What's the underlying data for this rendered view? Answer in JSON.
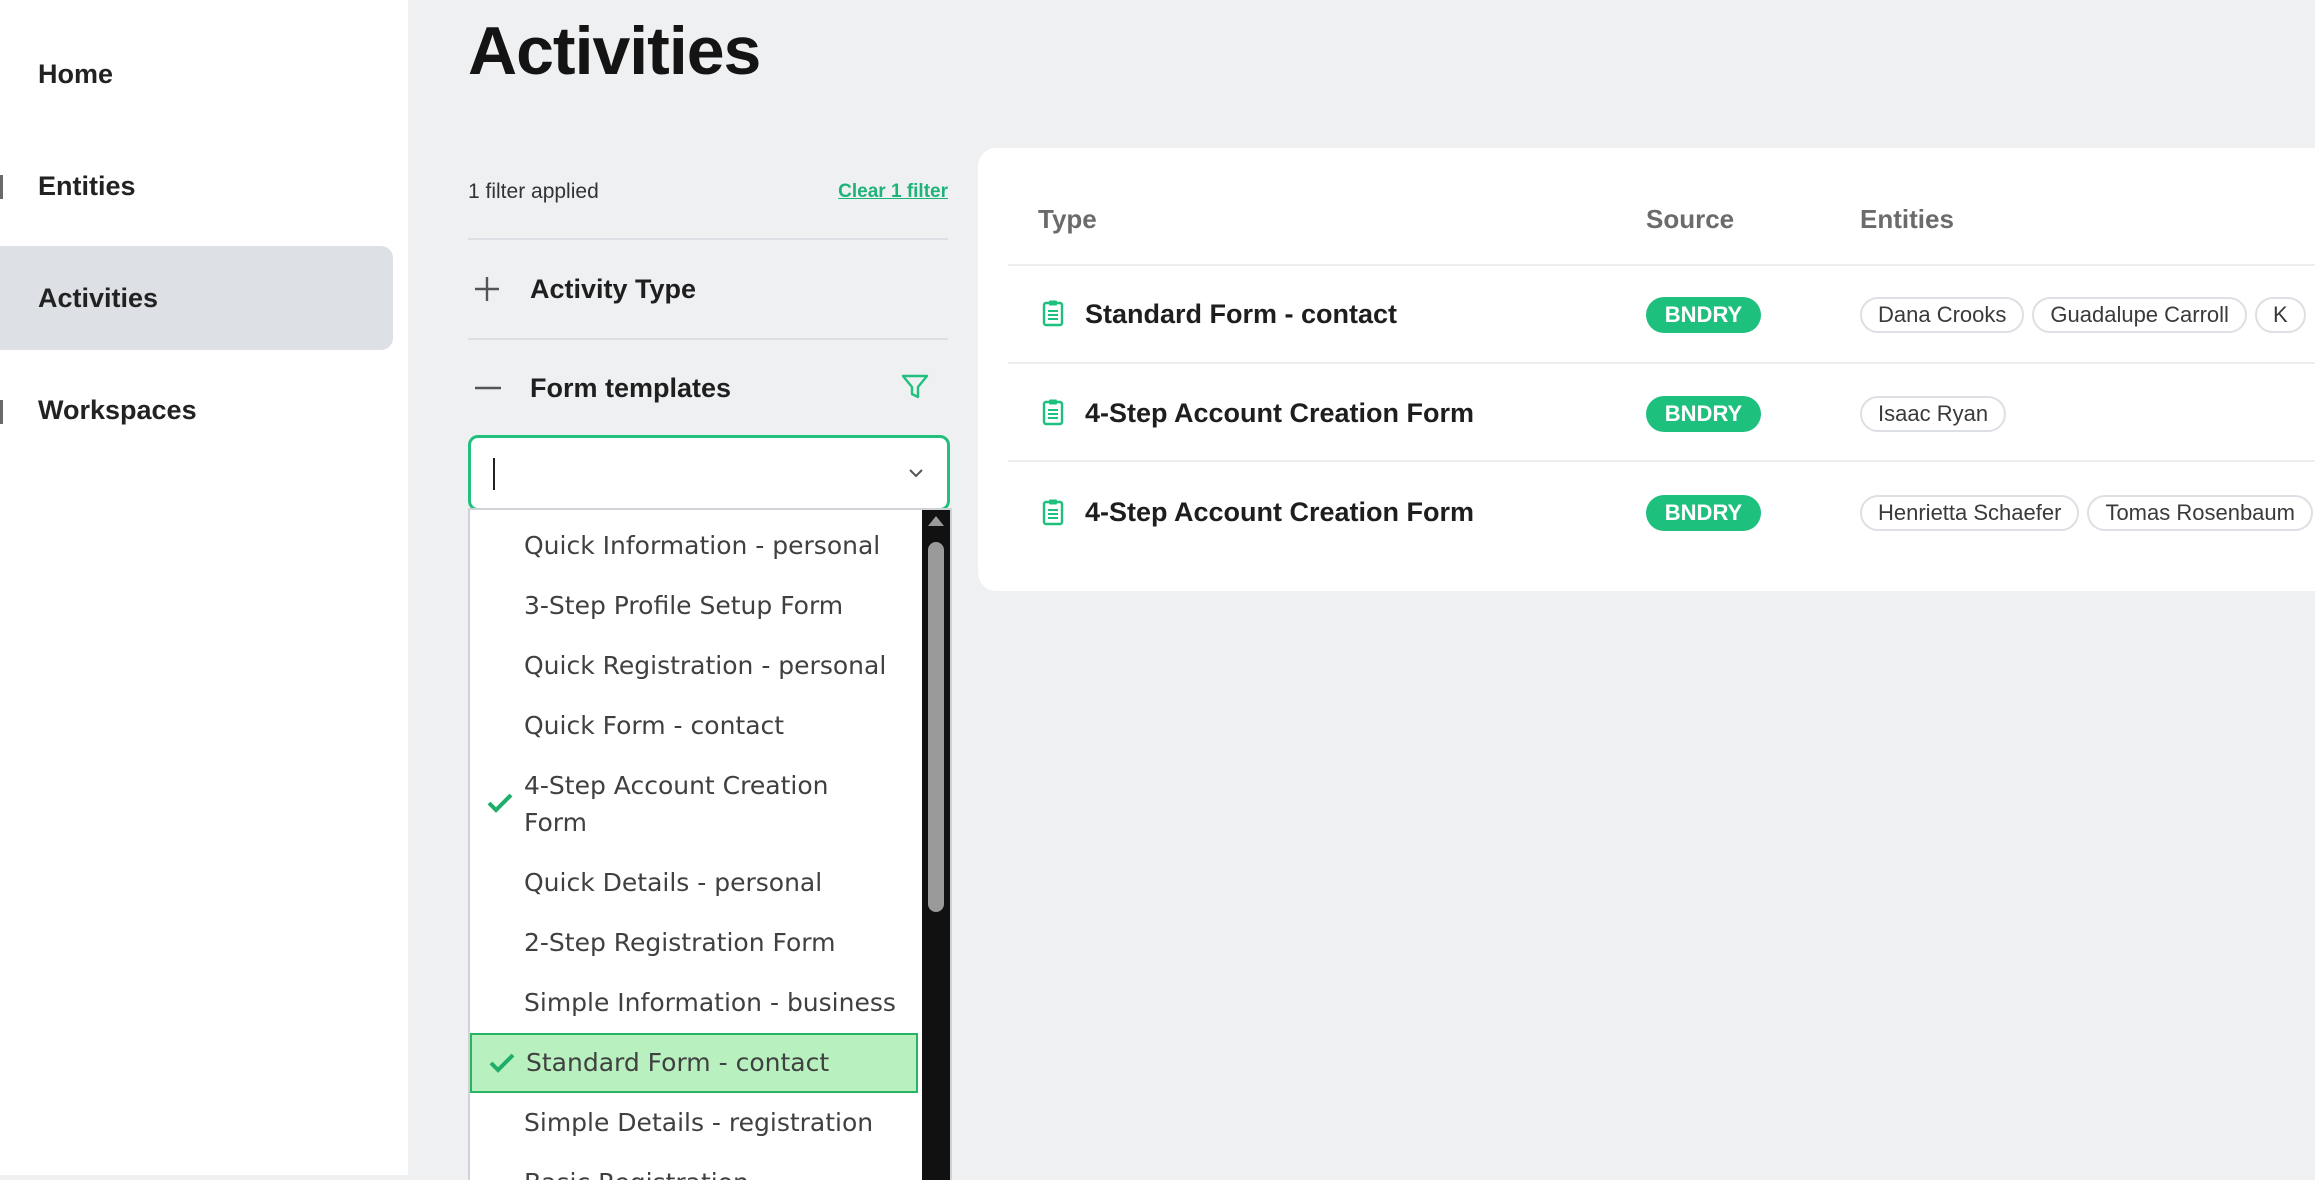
{
  "sidebar": {
    "items": [
      {
        "label": "Home",
        "active": false
      },
      {
        "label": "Entities",
        "active": false
      },
      {
        "label": "Activities",
        "active": true
      },
      {
        "label": "Workspaces",
        "active": false
      }
    ]
  },
  "page": {
    "title": "Activities"
  },
  "filters": {
    "applied_text": "1 filter applied",
    "clear_label": "Clear 1 filter",
    "sections": [
      {
        "label": "Activity Type",
        "expanded": false
      },
      {
        "label": "Form templates",
        "expanded": true
      }
    ],
    "combo": {
      "value": "",
      "placeholder": ""
    },
    "options": [
      {
        "label": "Quick Information - personal",
        "checked": false
      },
      {
        "label": "3-Step Profile Setup Form",
        "checked": false
      },
      {
        "label": "Quick Registration - personal",
        "checked": false
      },
      {
        "label": "Quick Form - contact",
        "checked": false
      },
      {
        "label": "4-Step Account Creation Form",
        "checked": true
      },
      {
        "label": "Quick Details - personal",
        "checked": false
      },
      {
        "label": "2-Step Registration Form",
        "checked": false
      },
      {
        "label": "Simple Information - business",
        "checked": false
      },
      {
        "label": "Standard Form - contact",
        "checked": true,
        "highlighted": true
      },
      {
        "label": "Simple Details - registration",
        "checked": false
      },
      {
        "label": "Basic Registration",
        "checked": false
      }
    ]
  },
  "table": {
    "headers": {
      "type": "Type",
      "source": "Source",
      "entities": "Entities"
    },
    "rows": [
      {
        "type": "Standard Form - contact",
        "source": "BNDRY",
        "entities": [
          "Dana Crooks",
          "Guadalupe Carroll",
          "K"
        ]
      },
      {
        "type": "4-Step Account Creation Form",
        "source": "BNDRY",
        "entities": [
          "Isaac Ryan"
        ]
      },
      {
        "type": "4-Step Account Creation Form",
        "source": "BNDRY",
        "entities": [
          "Henrietta Schaefer",
          "Tomas Rosenbaum"
        ]
      }
    ]
  },
  "colors": {
    "accent": "#1ec07d",
    "highlight": "#b8f1bf",
    "active_nav": "#dde1e6"
  }
}
